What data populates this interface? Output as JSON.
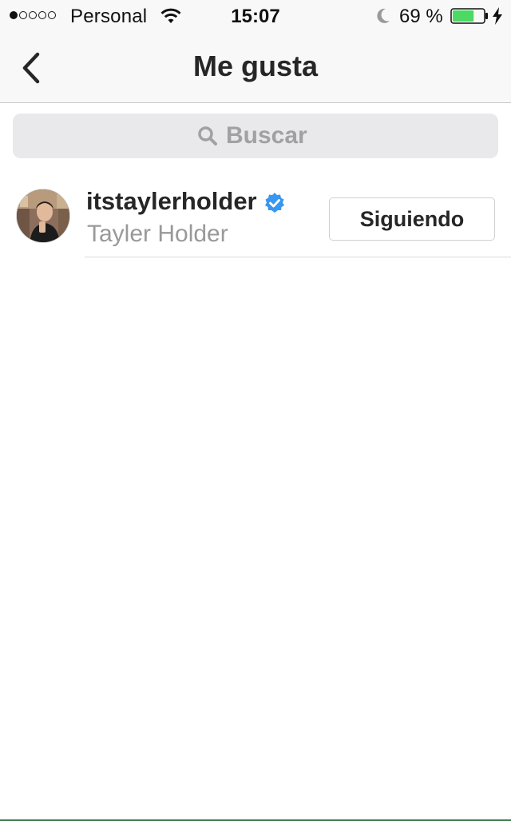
{
  "status_bar": {
    "carrier": "Personal",
    "time": "15:07",
    "battery_percent": "69 %",
    "battery_level": 0.69,
    "signal_bars": 1,
    "signal_total": 5
  },
  "nav": {
    "title": "Me gusta",
    "back_icon": "chevron-left-icon"
  },
  "search": {
    "placeholder": "Buscar",
    "value": "",
    "icon": "search-icon"
  },
  "likes": [
    {
      "username": "itstaylerholder",
      "full_name": "Tayler Holder",
      "verified": true,
      "button_label": "Siguiendo"
    }
  ],
  "colors": {
    "verified_blue": "#3897f0",
    "battery_green": "#4cd964",
    "text_primary": "#262626",
    "text_secondary": "#999999"
  }
}
